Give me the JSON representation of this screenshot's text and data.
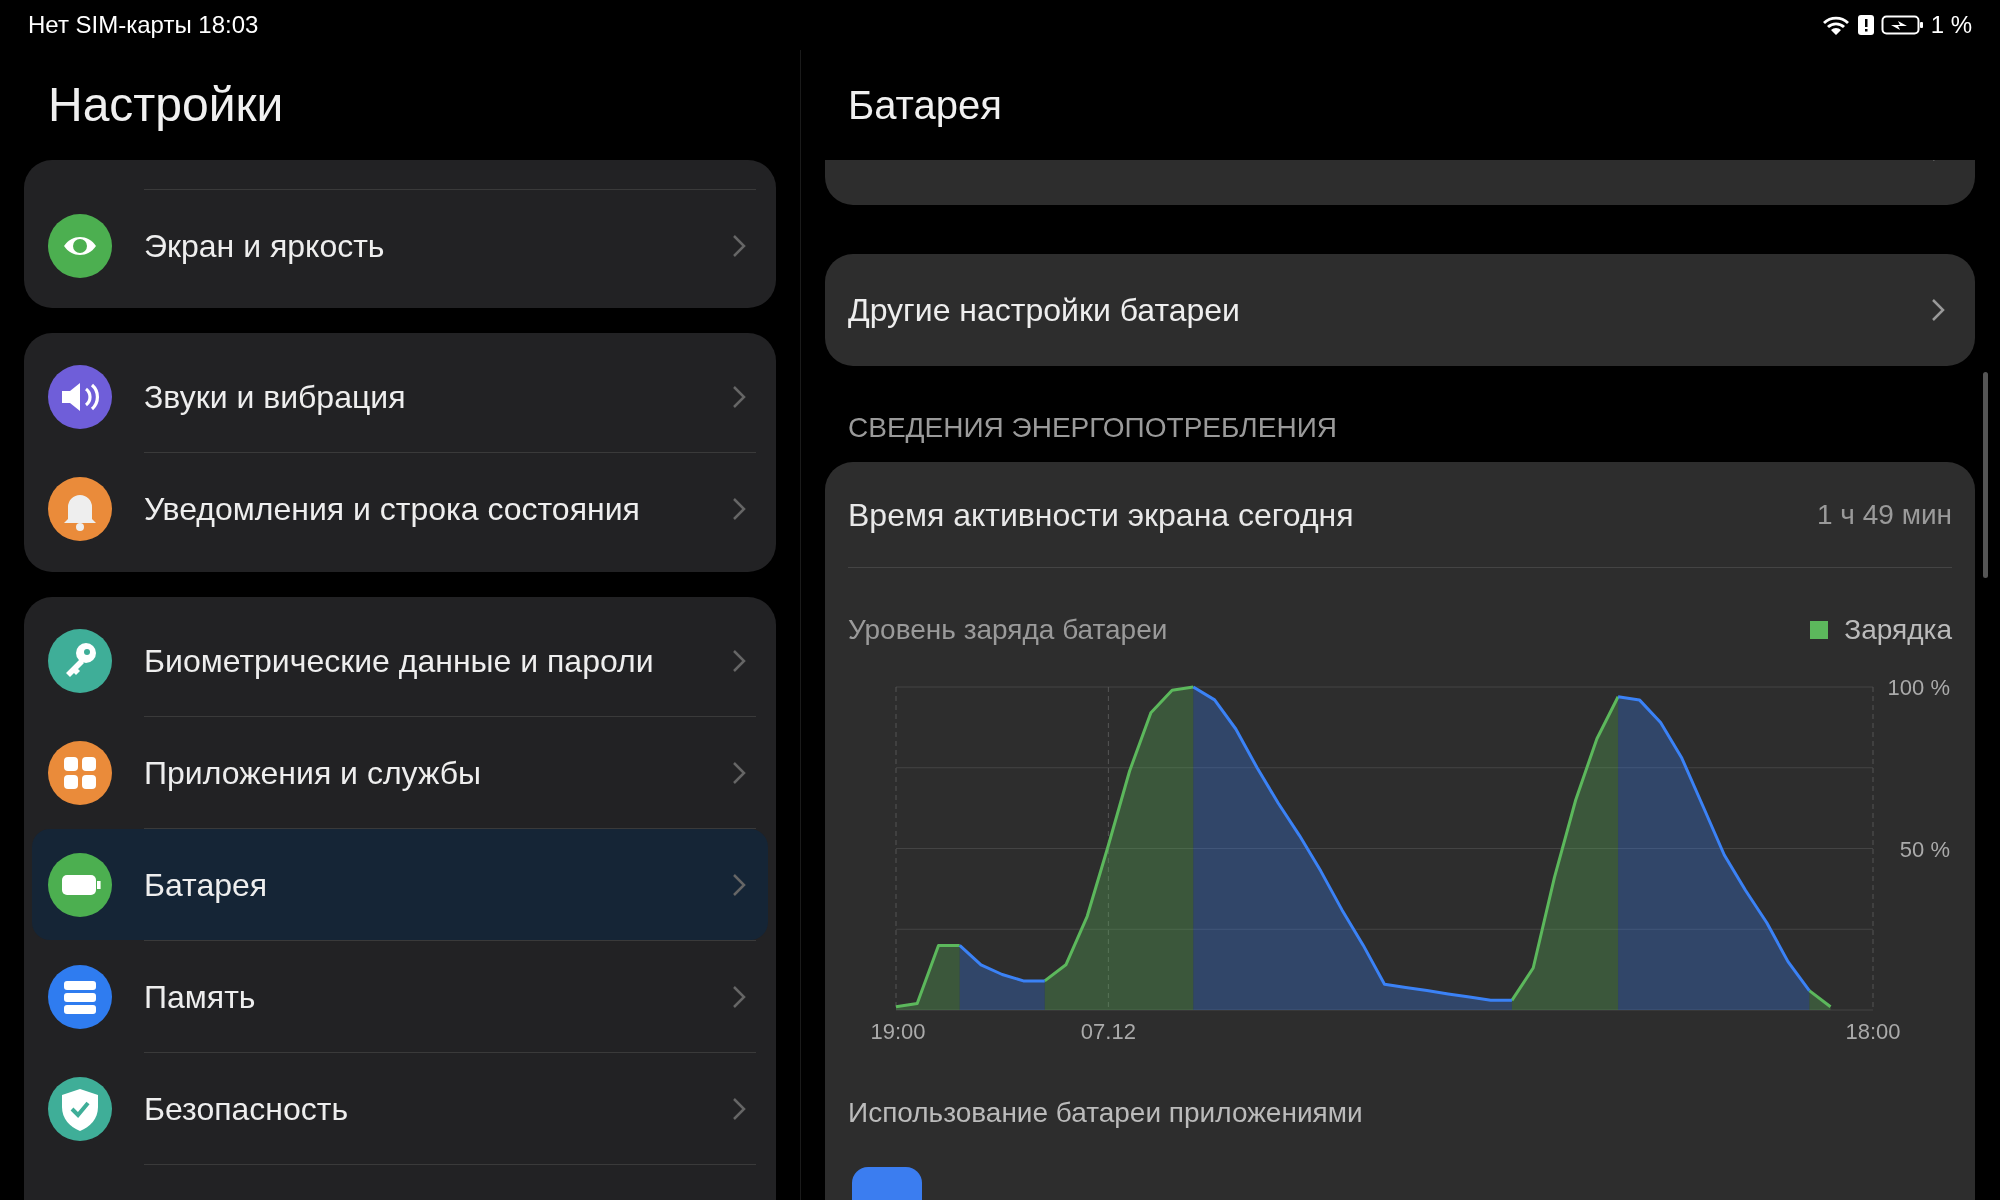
{
  "status_bar": {
    "left_text": "Нет SIM-карты 18:03",
    "battery_percent": "1 %"
  },
  "left_panel": {
    "title": "Настройки",
    "groups": [
      {
        "items": [
          {
            "label": "Экран и яркость",
            "selected": false
          }
        ]
      },
      {
        "items": [
          {
            "label": "Звуки и вибрация",
            "selected": false
          },
          {
            "label": "Уведомления и строка состояния",
            "selected": false
          }
        ]
      },
      {
        "items": [
          {
            "label": "Биометрические данные и пароли",
            "selected": false
          },
          {
            "label": "Приложения и службы",
            "selected": false
          },
          {
            "label": "Батарея",
            "selected": true
          },
          {
            "label": "Память",
            "selected": false
          },
          {
            "label": "Безопасность",
            "selected": false
          }
        ]
      }
    ]
  },
  "right_panel": {
    "title": "Батарея",
    "other_settings": "Другие настройки батареи",
    "section_title": "СВЕДЕНИЯ ЭНЕРГОПОТРЕБЛЕНИЯ",
    "screen_time": {
      "label": "Время активности экрана сегодня",
      "value": "1 ч 49 мин"
    },
    "chart_data": {
      "type": "area",
      "title": "Уровень заряда батареи",
      "categories": [
        "19:00",
        null,
        null,
        null,
        null,
        null,
        null,
        null,
        null,
        null,
        "07.12",
        null,
        null,
        null,
        null,
        null,
        null,
        null,
        null,
        null,
        null,
        null,
        null,
        null,
        null,
        null,
        null,
        null,
        null,
        null,
        null,
        null,
        null,
        null,
        null,
        null,
        null,
        null,
        null,
        null,
        null,
        null,
        null,
        null,
        null,
        null,
        "18:00"
      ],
      "series": [
        {
          "name": "Зарядка",
          "color": "#5cb85c",
          "values": [
            1,
            2,
            20,
            20,
            null,
            null,
            null,
            9,
            14,
            29,
            51,
            74,
            92,
            99,
            100,
            null,
            null,
            null,
            null,
            null,
            null,
            null,
            null,
            null,
            null,
            null,
            null,
            null,
            null,
            3,
            13,
            41,
            65,
            84,
            97,
            null,
            null,
            null,
            null,
            null,
            null,
            null,
            null,
            6,
            1,
            null,
            null
          ]
        },
        {
          "color": "#3b82f6",
          "values": [
            null,
            null,
            null,
            20,
            14,
            11,
            9,
            9,
            null,
            null,
            null,
            null,
            null,
            null,
            100,
            96,
            87,
            75,
            64,
            54,
            43,
            31,
            20,
            8,
            7,
            6,
            5,
            4,
            3,
            3,
            null,
            null,
            null,
            null,
            97,
            96,
            89,
            78,
            63,
            48,
            37,
            27,
            15,
            6,
            null,
            null,
            null
          ]
        }
      ],
      "ylim": [
        0,
        100
      ],
      "yticks": [
        {
          "value": 50,
          "label": "50 %"
        },
        {
          "value": 100,
          "label": "100 %"
        }
      ]
    },
    "apps_usage_title": "Использование батареи приложениями"
  }
}
